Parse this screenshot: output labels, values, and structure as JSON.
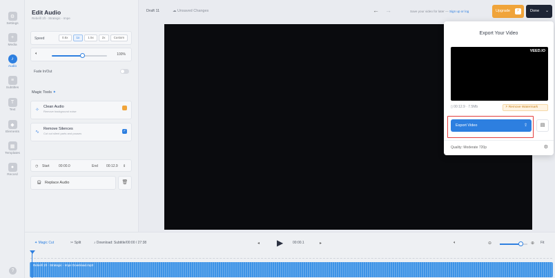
{
  "rail": [
    {
      "label": "Settings",
      "icon": "gear-icon"
    },
    {
      "label": "Media",
      "icon": "plus-icon"
    },
    {
      "label": "Audio",
      "icon": "music-note-icon",
      "active": true
    },
    {
      "label": "Subtitles",
      "icon": "subtitles-icon"
    },
    {
      "label": "Text",
      "icon": "text-icon"
    },
    {
      "label": "Elements",
      "icon": "shapes-icon"
    },
    {
      "label": "Templates",
      "icon": "templates-icon"
    },
    {
      "label": "Record",
      "icon": "record-icon"
    }
  ],
  "help_label": "?",
  "panel": {
    "title": "Edit Audio",
    "subtitle": "Rebelll 1ft - Strategic - Impe",
    "speed_label": "Speed",
    "speed_options": [
      "0.5x",
      "1x",
      "1.5x",
      "2x",
      "Custom"
    ],
    "speed_selected": "1x",
    "volume_value": "100%",
    "volume_fraction": 0.55,
    "fade_label": "Fade In/Out",
    "magic_tools_title": "Magic Tools",
    "magic_tools_icon": "sparkle-icon",
    "tools": [
      {
        "name": "Clean Audio",
        "desc": "Remove background noise",
        "icon": "sparkle-icon"
      },
      {
        "name": "Remove Silences",
        "desc": "Cut out silent parts and pauses",
        "icon": "waveform-icon"
      }
    ],
    "start_label": "Start",
    "start_value": "00:00.0",
    "end_label": "End",
    "end_value": "00:12.9",
    "preview_label": "Replace Audio",
    "preview_icon": "headphones-icon",
    "delete_icon": "trash-icon"
  },
  "topbar": {
    "project_name": "Draft 11",
    "unsaved_label": "Unsaved Changes",
    "save_text_prefix": "Save your video for later —",
    "save_link": "Sign up or log",
    "upgrade_label": "Upgrade",
    "done_label": "Done"
  },
  "export": {
    "title": "Export Your Video",
    "watermark": "VEED.IO",
    "meta": "00:12.9 · 7.5Mb",
    "remove_watermark": "Remove Watermark",
    "export_button": "Export Video",
    "quality": "Quality: Moderate 720p",
    "accent": "#2d7fe0",
    "highlight_color": "#e33b3b"
  },
  "timeline": {
    "magic_cut": "Magic Cut",
    "split": "Split",
    "track_meta": "Download: Subtitle/00:00 / 27:38",
    "current_time": "00:00.1",
    "track_label": "Rebelll 1ft - Strategic - Impe Download.mp3",
    "zoom_fraction": 0.75,
    "fit_label": "Fit"
  }
}
